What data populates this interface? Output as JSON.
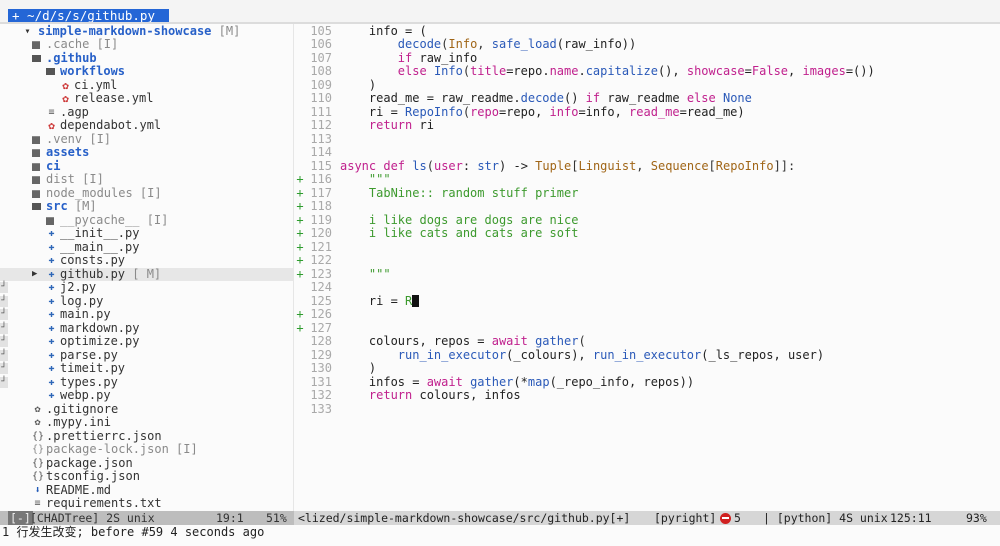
{
  "tab": {
    "label": "+ ~/d/s/s/github.py"
  },
  "tree": {
    "items": [
      {
        "name": "simple-markdown-showcase",
        "badge": "[M]",
        "kind": "root"
      },
      {
        "name": ".cache",
        "badge": "[I]",
        "kind": "dir-dim",
        "depth": 1
      },
      {
        "name": ".github",
        "badge": "",
        "kind": "dir-open",
        "depth": 1
      },
      {
        "name": "workflows",
        "badge": "",
        "kind": "dir-open",
        "depth": 2
      },
      {
        "name": "ci.yml",
        "badge": "",
        "kind": "gear",
        "depth": 3
      },
      {
        "name": "release.yml",
        "badge": "",
        "kind": "gear",
        "depth": 3
      },
      {
        "name": ".agp",
        "badge": "",
        "kind": "lines",
        "depth": 2
      },
      {
        "name": "dependabot.yml",
        "badge": "",
        "kind": "gear",
        "depth": 2
      },
      {
        "name": ".venv",
        "badge": "[I]",
        "kind": "dir-dim",
        "depth": 1
      },
      {
        "name": "assets",
        "badge": "",
        "kind": "dir",
        "depth": 1
      },
      {
        "name": "ci",
        "badge": "",
        "kind": "dir",
        "depth": 1
      },
      {
        "name": "dist",
        "badge": "[I]",
        "kind": "dir-dim",
        "depth": 1
      },
      {
        "name": "node_modules",
        "badge": "[I]",
        "kind": "dir-dim",
        "depth": 1
      },
      {
        "name": "src",
        "badge": "[M]",
        "kind": "dir-open",
        "depth": 1
      },
      {
        "name": "__pycache__",
        "badge": "[I]",
        "kind": "dir-dim",
        "depth": 2
      },
      {
        "name": "__init__.py",
        "badge": "",
        "kind": "py",
        "depth": 2
      },
      {
        "name": "__main__.py",
        "badge": "",
        "kind": "py",
        "depth": 2
      },
      {
        "name": "consts.py",
        "badge": "",
        "kind": "py",
        "depth": 2
      },
      {
        "name": "github.py",
        "badge": "[ M]",
        "kind": "py",
        "depth": 2,
        "cursor": true
      },
      {
        "name": "j2.py",
        "badge": "",
        "kind": "py",
        "depth": 2,
        "git": true
      },
      {
        "name": "log.py",
        "badge": "",
        "kind": "py",
        "depth": 2,
        "git": true
      },
      {
        "name": "main.py",
        "badge": "",
        "kind": "py",
        "depth": 2,
        "git": true
      },
      {
        "name": "markdown.py",
        "badge": "",
        "kind": "py",
        "depth": 2,
        "git": true
      },
      {
        "name": "optimize.py",
        "badge": "",
        "kind": "py",
        "depth": 2,
        "git": true
      },
      {
        "name": "parse.py",
        "badge": "",
        "kind": "py",
        "depth": 2,
        "git": true
      },
      {
        "name": "timeit.py",
        "badge": "",
        "kind": "py",
        "depth": 2,
        "git": true
      },
      {
        "name": "types.py",
        "badge": "",
        "kind": "py",
        "depth": 2,
        "git": true
      },
      {
        "name": "webp.py",
        "badge": "",
        "kind": "py",
        "depth": 2
      },
      {
        "name": ".gitignore",
        "badge": "",
        "kind": "cfg",
        "depth": 1
      },
      {
        "name": ".mypy.ini",
        "badge": "",
        "kind": "cfg",
        "depth": 1
      },
      {
        "name": ".prettierrc.json",
        "badge": "",
        "kind": "json",
        "depth": 1
      },
      {
        "name": "package-lock.json",
        "badge": "[I]",
        "kind": "json-dim",
        "depth": 1
      },
      {
        "name": "package.json",
        "badge": "",
        "kind": "json",
        "depth": 1
      },
      {
        "name": "tsconfig.json",
        "badge": "",
        "kind": "json",
        "depth": 1
      },
      {
        "name": "README.md",
        "badge": "",
        "kind": "md",
        "depth": 1
      },
      {
        "name": "requirements.txt",
        "badge": "",
        "kind": "txt",
        "depth": 1
      }
    ]
  },
  "editor": {
    "lines": [
      {
        "n": "105",
        "sign": "",
        "code": [
          [
            "    info = (",
            "plain"
          ]
        ]
      },
      {
        "n": "106",
        "sign": "",
        "code": [
          [
            "        ",
            "plain"
          ],
          [
            "decode",
            "fn"
          ],
          [
            "(",
            "punct"
          ],
          [
            "Info",
            "cls"
          ],
          [
            ", ",
            "punct"
          ],
          [
            "safe_load",
            "fn"
          ],
          [
            "(raw_info))",
            "plain"
          ]
        ]
      },
      {
        "n": "107",
        "sign": "",
        "code": [
          [
            "        ",
            "plain"
          ],
          [
            "if",
            "kw"
          ],
          [
            " raw_info",
            "plain"
          ]
        ]
      },
      {
        "n": "108",
        "sign": "",
        "code": [
          [
            "        ",
            "plain"
          ],
          [
            "else",
            "kw"
          ],
          [
            " ",
            "plain"
          ],
          [
            "Info",
            "fn"
          ],
          [
            "(",
            "punct"
          ],
          [
            "title",
            "attr"
          ],
          [
            "=repo.",
            "plain"
          ],
          [
            "name",
            "attr"
          ],
          [
            ".",
            "plain"
          ],
          [
            "capitalize",
            "fn"
          ],
          [
            "(), ",
            "plain"
          ],
          [
            "showcase",
            "attr"
          ],
          [
            "=",
            "plain"
          ],
          [
            "False",
            "const"
          ],
          [
            ", ",
            "plain"
          ],
          [
            "images",
            "attr"
          ],
          [
            "=())",
            "plain"
          ]
        ]
      },
      {
        "n": "109",
        "sign": "",
        "code": [
          [
            "    )",
            "plain"
          ]
        ]
      },
      {
        "n": "110",
        "sign": "",
        "code": [
          [
            "    read_me = raw_readme.",
            "plain"
          ],
          [
            "decode",
            "fn"
          ],
          [
            "() ",
            "plain"
          ],
          [
            "if",
            "kw"
          ],
          [
            " raw_readme ",
            "plain"
          ],
          [
            "else",
            "kw"
          ],
          [
            " ",
            "plain"
          ],
          [
            "None",
            "fn"
          ]
        ]
      },
      {
        "n": "111",
        "sign": "",
        "code": [
          [
            "    ri = ",
            "plain"
          ],
          [
            "RepoInfo",
            "fn"
          ],
          [
            "(",
            "punct"
          ],
          [
            "repo",
            "attr"
          ],
          [
            "=repo, ",
            "plain"
          ],
          [
            "info",
            "attr"
          ],
          [
            "=info, ",
            "plain"
          ],
          [
            "read_me",
            "attr"
          ],
          [
            "=read_me)",
            "plain"
          ]
        ]
      },
      {
        "n": "112",
        "sign": "",
        "code": [
          [
            "    ",
            "plain"
          ],
          [
            "return",
            "kw"
          ],
          [
            " ri",
            "plain"
          ]
        ]
      },
      {
        "n": "113",
        "sign": "",
        "code": []
      },
      {
        "n": "114",
        "sign": "",
        "code": []
      },
      {
        "n": "115",
        "sign": "",
        "code": [
          [
            "async",
            "kw"
          ],
          [
            " ",
            "plain"
          ],
          [
            "def",
            "kw"
          ],
          [
            " ",
            "plain"
          ],
          [
            "ls",
            "def"
          ],
          [
            "(",
            "punct"
          ],
          [
            "user",
            "attr"
          ],
          [
            ": ",
            "plain"
          ],
          [
            "str",
            "fn"
          ],
          [
            ") -> ",
            "plain"
          ],
          [
            "Tuple",
            "cls"
          ],
          [
            "[",
            "punct"
          ],
          [
            "Linguist",
            "cls"
          ],
          [
            ", ",
            "punct"
          ],
          [
            "Sequence",
            "cls"
          ],
          [
            "[",
            "punct"
          ],
          [
            "RepoInfo",
            "cls"
          ],
          [
            "]]:",
            "punct"
          ]
        ]
      },
      {
        "n": "116",
        "sign": "+",
        "code": [
          [
            "    ",
            "plain"
          ],
          [
            "\"\"\"",
            "str"
          ]
        ]
      },
      {
        "n": "117",
        "sign": "+",
        "code": [
          [
            "    ",
            "plain"
          ],
          [
            "TabNine:: random stuff primer",
            "str"
          ]
        ]
      },
      {
        "n": "118",
        "sign": "+",
        "code": []
      },
      {
        "n": "119",
        "sign": "+",
        "code": [
          [
            "    ",
            "plain"
          ],
          [
            "i like dogs are dogs are nice",
            "str"
          ]
        ]
      },
      {
        "n": "120",
        "sign": "+",
        "code": [
          [
            "    ",
            "plain"
          ],
          [
            "i like cats and cats are soft",
            "str"
          ]
        ]
      },
      {
        "n": "121",
        "sign": "+",
        "code": []
      },
      {
        "n": "122",
        "sign": "+",
        "code": []
      },
      {
        "n": "123",
        "sign": "+",
        "code": [
          [
            "    ",
            "plain"
          ],
          [
            "\"\"\"",
            "str"
          ]
        ]
      },
      {
        "n": "124",
        "sign": "",
        "code": []
      },
      {
        "n": "125",
        "sign": "",
        "code": [
          [
            "    ri = ",
            "plain"
          ],
          [
            "R",
            "str"
          ]
        ],
        "cursor": true
      },
      {
        "n": "126",
        "sign": "+",
        "code": []
      },
      {
        "n": "127",
        "sign": "+",
        "code": []
      },
      {
        "n": "128",
        "sign": "",
        "code": [
          [
            "    colours, repos = ",
            "plain"
          ],
          [
            "await",
            "kw"
          ],
          [
            " ",
            "plain"
          ],
          [
            "gather",
            "fn"
          ],
          [
            "(",
            "punct"
          ]
        ]
      },
      {
        "n": "129",
        "sign": "",
        "code": [
          [
            "        ",
            "plain"
          ],
          [
            "run_in_executor",
            "fn"
          ],
          [
            "(_colours), ",
            "plain"
          ],
          [
            "run_in_executor",
            "fn"
          ],
          [
            "(_ls_repos, user)",
            "plain"
          ]
        ]
      },
      {
        "n": "130",
        "sign": "",
        "code": [
          [
            "    )",
            "plain"
          ]
        ]
      },
      {
        "n": "131",
        "sign": "",
        "code": [
          [
            "    infos = ",
            "plain"
          ],
          [
            "await",
            "kw"
          ],
          [
            " ",
            "plain"
          ],
          [
            "gather",
            "fn"
          ],
          [
            "(*",
            "plain"
          ],
          [
            "map",
            "fn"
          ],
          [
            "(_repo_info, repos))",
            "plain"
          ]
        ]
      },
      {
        "n": "132",
        "sign": "",
        "code": [
          [
            "    ",
            "plain"
          ],
          [
            "return",
            "kw"
          ],
          [
            " colours, infos",
            "plain"
          ]
        ]
      },
      {
        "n": "133",
        "sign": "",
        "code": []
      }
    ]
  },
  "status": {
    "left_mode": "[-]",
    "left_text": "[CHADTree] 2S unix",
    "left_pos": "19:1",
    "left_pct": "51%",
    "path": "<lized/simple-markdown-showcase/src/github.py[+]",
    "lsp": "[pyright]",
    "err_count": "5",
    "filetype": "| [python] 4S unix",
    "cursor_pos": "125:11",
    "pct": "93%"
  },
  "cmdline": "1 行发生改变; before #59  4 seconds ago"
}
